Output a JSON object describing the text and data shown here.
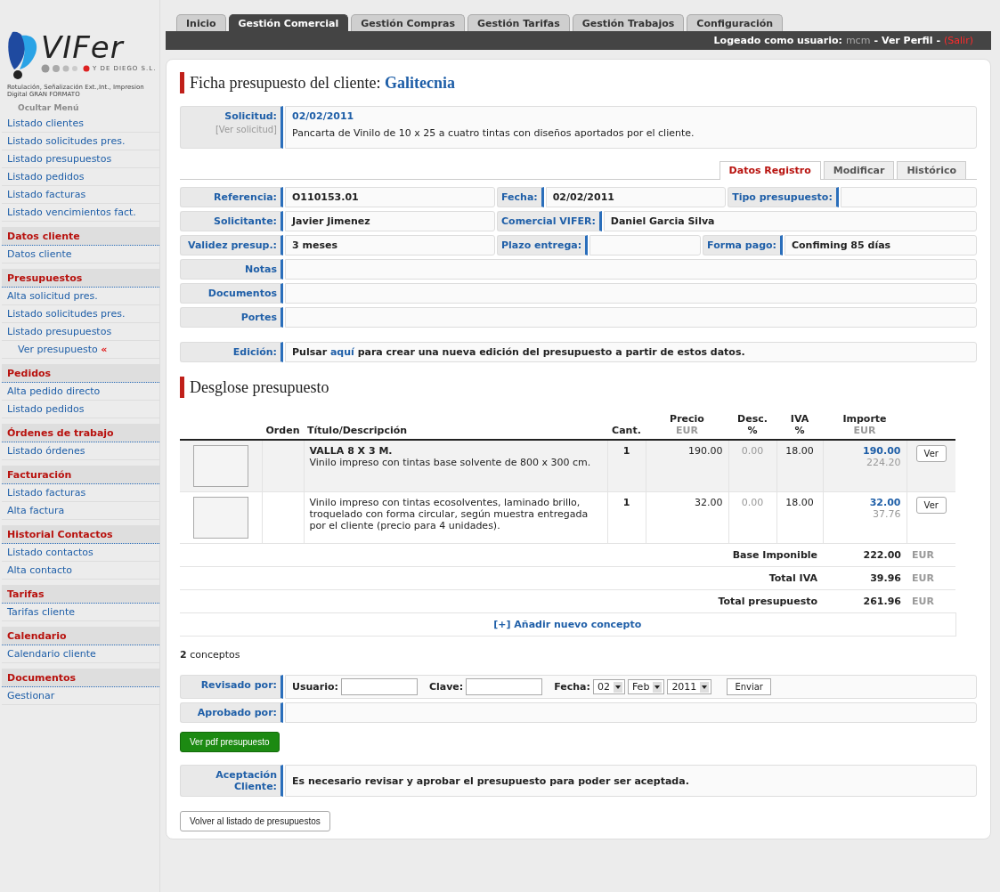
{
  "logo": {
    "name": "VIFer",
    "company": "Y DE DIEGO S.L.",
    "tagline": "Rotulación, Señalización Ext.,Int., Impresion Digital GRAN FORMATO"
  },
  "sidebar": {
    "toggle": "Ocultar Menú",
    "sections": [
      {
        "items": [
          {
            "label": "Listado clientes"
          },
          {
            "label": "Listado solicitudes pres."
          },
          {
            "label": "Listado presupuestos"
          },
          {
            "label": "Listado pedidos"
          },
          {
            "label": "Listado facturas"
          },
          {
            "label": "Listado vencimientos fact."
          }
        ]
      },
      {
        "heading": "Datos cliente",
        "items": [
          {
            "label": "Datos cliente"
          }
        ]
      },
      {
        "heading": "Presupuestos",
        "items": [
          {
            "label": "Alta solicitud pres."
          },
          {
            "label": "Listado solicitudes pres."
          },
          {
            "label": "Listado presupuestos",
            "children": [
              {
                "label": "Ver presupuesto",
                "selected": true,
                "marker": "«"
              }
            ]
          }
        ]
      },
      {
        "heading": "Pedidos",
        "items": [
          {
            "label": "Alta pedido directo"
          },
          {
            "label": "Listado pedidos"
          }
        ]
      },
      {
        "heading": "Órdenes de trabajo",
        "items": [
          {
            "label": "Listado órdenes"
          }
        ]
      },
      {
        "heading": "Facturación",
        "items": [
          {
            "label": "Listado facturas"
          },
          {
            "label": "Alta factura"
          }
        ]
      },
      {
        "heading": "Historial Contactos",
        "items": [
          {
            "label": "Listado contactos"
          },
          {
            "label": "Alta contacto"
          }
        ]
      },
      {
        "heading": "Tarifas",
        "items": [
          {
            "label": "Tarifas cliente"
          }
        ]
      },
      {
        "heading": "Calendario",
        "items": [
          {
            "label": "Calendario cliente"
          }
        ]
      },
      {
        "heading": "Documentos",
        "items": [
          {
            "label": "Gestionar"
          }
        ]
      }
    ]
  },
  "tabs": [
    {
      "label": "Inicio",
      "selected": false
    },
    {
      "label": "Gestión Comercial",
      "selected": true
    },
    {
      "label": "Gestión Compras",
      "selected": false
    },
    {
      "label": "Gestión Tarifas",
      "selected": false
    },
    {
      "label": "Gestión Trabajos",
      "selected": false
    },
    {
      "label": "Configuración",
      "selected": false
    }
  ],
  "user_bar": {
    "label": "Logeado como usuario:",
    "user": "mcm",
    "separator_1": "-",
    "profile_link": "Ver Perfil",
    "separator_2": "-",
    "logout_link": "(Salir)"
  },
  "page_title": {
    "prefix": "Ficha presupuesto del cliente:",
    "client": "Galitecnia"
  },
  "solicitud": {
    "label": "Solicitud:",
    "link": "[Ver solicitud]",
    "date": "02/02/2011",
    "description": "Pancarta de Vinilo de 10 x 25 a cuatro tintas con diseños aportados por el cliente."
  },
  "subtabs": [
    {
      "label": "Datos Registro",
      "selected": true
    },
    {
      "label": "Modificar",
      "selected": false
    },
    {
      "label": "Histórico",
      "selected": false
    }
  ],
  "field_rows": [
    [
      {
        "label": "Referencia:",
        "value": "O110153.01"
      },
      {
        "label": "Fecha:",
        "value": "02/02/2011"
      },
      {
        "label": "Tipo presupuesto:"
      }
    ],
    [
      {
        "label": "Solicitante:",
        "value": "Javier Jimenez"
      },
      {
        "label": "Comercial VIFER:",
        "value": "Daniel Garcia Silva"
      }
    ],
    [
      {
        "label": "Validez presup.:",
        "value": "3 meses"
      },
      {
        "label": "Plazo entrega:"
      },
      {
        "label": "Forma pago:",
        "value": "Confiming 85 días"
      }
    ],
    [
      {
        "label": "Notas"
      }
    ],
    [
      {
        "label": "Documentos"
      }
    ],
    [
      {
        "label": "Portes"
      }
    ]
  ],
  "edicion": {
    "label": "Edición:",
    "before": "Pulsar",
    "link": "aquí",
    "after": "para crear una nueva edición del presupuesto a partir de estos datos."
  },
  "section_title": "Desglose presupuesto",
  "table": {
    "columns": [
      {
        "title": "Orden"
      },
      {
        "title": "Título/Descripción"
      },
      {
        "title": "Cant."
      },
      {
        "title": "Precio",
        "unit": "EUR",
        "unit_muted": true
      },
      {
        "title": "Desc.",
        "unit": "%",
        "unit_muted": false
      },
      {
        "title": "IVA",
        "unit": "%",
        "unit_muted": false
      },
      {
        "title": "Importe",
        "unit": "EUR",
        "unit_muted": true
      }
    ],
    "rows": [
      {
        "highlighted": true,
        "title": "VALLA 8 X 3 M.",
        "description": "Vinilo impreso con tintas base solvente de 800 x 300 cm.",
        "quantity": "1",
        "price": "190.00",
        "discount": "0.00",
        "vat": "18.00",
        "amount": "190.00",
        "amount_with_vat": "224.20",
        "button": "Ver"
      },
      {
        "highlighted": false,
        "description": "Vinilo impreso con tintas ecosolventes, laminado brillo, troquelado con forma circular, según muestra entregada por el cliente (precio para 4 unidades).",
        "quantity": "1",
        "price": "32.00",
        "discount": "0.00",
        "vat": "18.00",
        "amount": "32.00",
        "amount_with_vat": "37.76",
        "button": "Ver"
      }
    ],
    "totals": [
      {
        "label": "Base Imponible",
        "value": "222.00",
        "currency": "EUR"
      },
      {
        "label": "Total IVA",
        "value": "39.96",
        "currency": "EUR"
      },
      {
        "label": "Total presupuesto",
        "value": "261.96",
        "currency": "EUR"
      }
    ],
    "add_link": "[+] Añadir nuevo concepto"
  },
  "count": "**2** conceptos",
  "review": {
    "label": "Revisado por:",
    "user_label": "Usuario:",
    "password_label": "Clave:",
    "date_label": "Fecha:",
    "day": "02",
    "month": "Feb",
    "year": "2011",
    "submit": "Enviar"
  },
  "approved": {
    "label": "Aprobado por:"
  },
  "pdf_button": "Ver pdf presupuesto",
  "acceptance": {
    "label": "Aceptación Cliente:",
    "text": "Es necesario revisar y aprobar el presupuesto para poder ser aceptada."
  },
  "back_button": "Volver al listado de presupuestos"
}
